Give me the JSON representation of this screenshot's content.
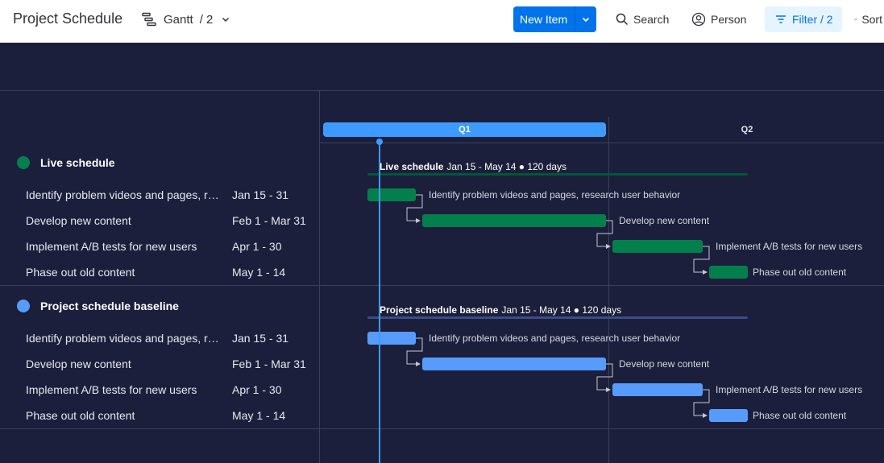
{
  "toolbar": {
    "title": "Project Schedule",
    "view_name": "Gantt",
    "view_count": "/ 2",
    "new_item_label": "New Item",
    "search_label": "Search",
    "person_label": "Person",
    "filter_label": "Filter / 2",
    "sort_label": "Sort"
  },
  "timeline": {
    "quarters": [
      "Q1",
      "Q2"
    ],
    "today_marker": "today-line"
  },
  "groups": [
    {
      "name": "Live schedule",
      "color": "#037f4c",
      "summary": "Jan 15 - May 14 ● 120 days",
      "tasks": [
        {
          "name": "Identify problem videos and pages, research user behavior",
          "dates": "Jan 15 - 31"
        },
        {
          "name": "Develop new content",
          "dates": "Feb 1 - Mar 31"
        },
        {
          "name": "Implement A/B tests for new users",
          "dates": "Apr 1 - 30"
        },
        {
          "name": "Phase out old content",
          "dates": "May 1 - 14"
        }
      ]
    },
    {
      "name": "Project schedule baseline",
      "color": "#579bfc",
      "summary": "Jan 15 - May 14 ● 120 days",
      "tasks": [
        {
          "name": "Identify problem videos and pages, research user behavior",
          "dates": "Jan 15 - 31"
        },
        {
          "name": "Develop new content",
          "dates": "Feb 1 - Mar 31"
        },
        {
          "name": "Implement A/B tests for new users",
          "dates": "Apr 1 - 30"
        },
        {
          "name": "Phase out old content",
          "dates": "May 1 - 14"
        }
      ]
    }
  ]
}
